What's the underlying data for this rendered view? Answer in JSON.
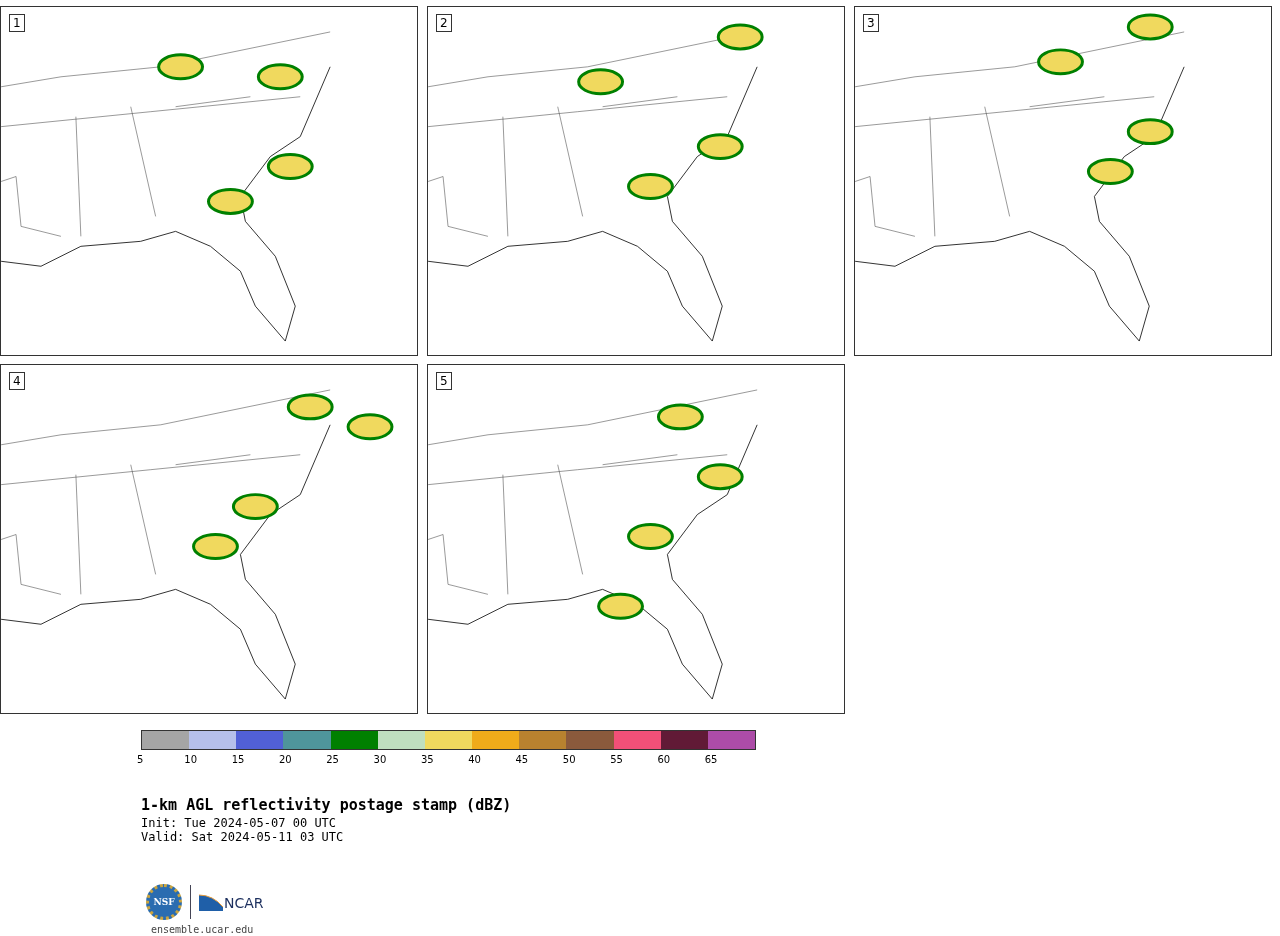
{
  "panels": [
    {
      "label": "1"
    },
    {
      "label": "2"
    },
    {
      "label": "3"
    },
    {
      "label": "4"
    },
    {
      "label": "5"
    }
  ],
  "colorbar": [
    {
      "label": "5",
      "color": "#a5a5a5"
    },
    {
      "label": "10",
      "color": "#b6c0ea"
    },
    {
      "label": "15",
      "color": "#5160d6"
    },
    {
      "label": "20",
      "color": "#4f959b"
    },
    {
      "label": "25",
      "color": "#008000"
    },
    {
      "label": "30",
      "color": "#bfdfbf"
    },
    {
      "label": "35",
      "color": "#f0d95e"
    },
    {
      "label": "40",
      "color": "#f0ab1a"
    },
    {
      "label": "45",
      "color": "#b8822f"
    },
    {
      "label": "50",
      "color": "#8b5a3c"
    },
    {
      "label": "55",
      "color": "#f25078"
    },
    {
      "label": "60",
      "color": "#611a36"
    },
    {
      "label": "65",
      "color": "#ad4ca8"
    }
  ],
  "title": "1-km AGL reflectivity postage stamp (dBZ)",
  "init": " Init: Tue 2024-05-07 00 UTC",
  "valid": "Valid: Sat 2024-05-11 03 UTC",
  "logos": {
    "nsf": "NSF",
    "ncar": "NCAR"
  },
  "url": "ensemble.ucar.edu"
}
